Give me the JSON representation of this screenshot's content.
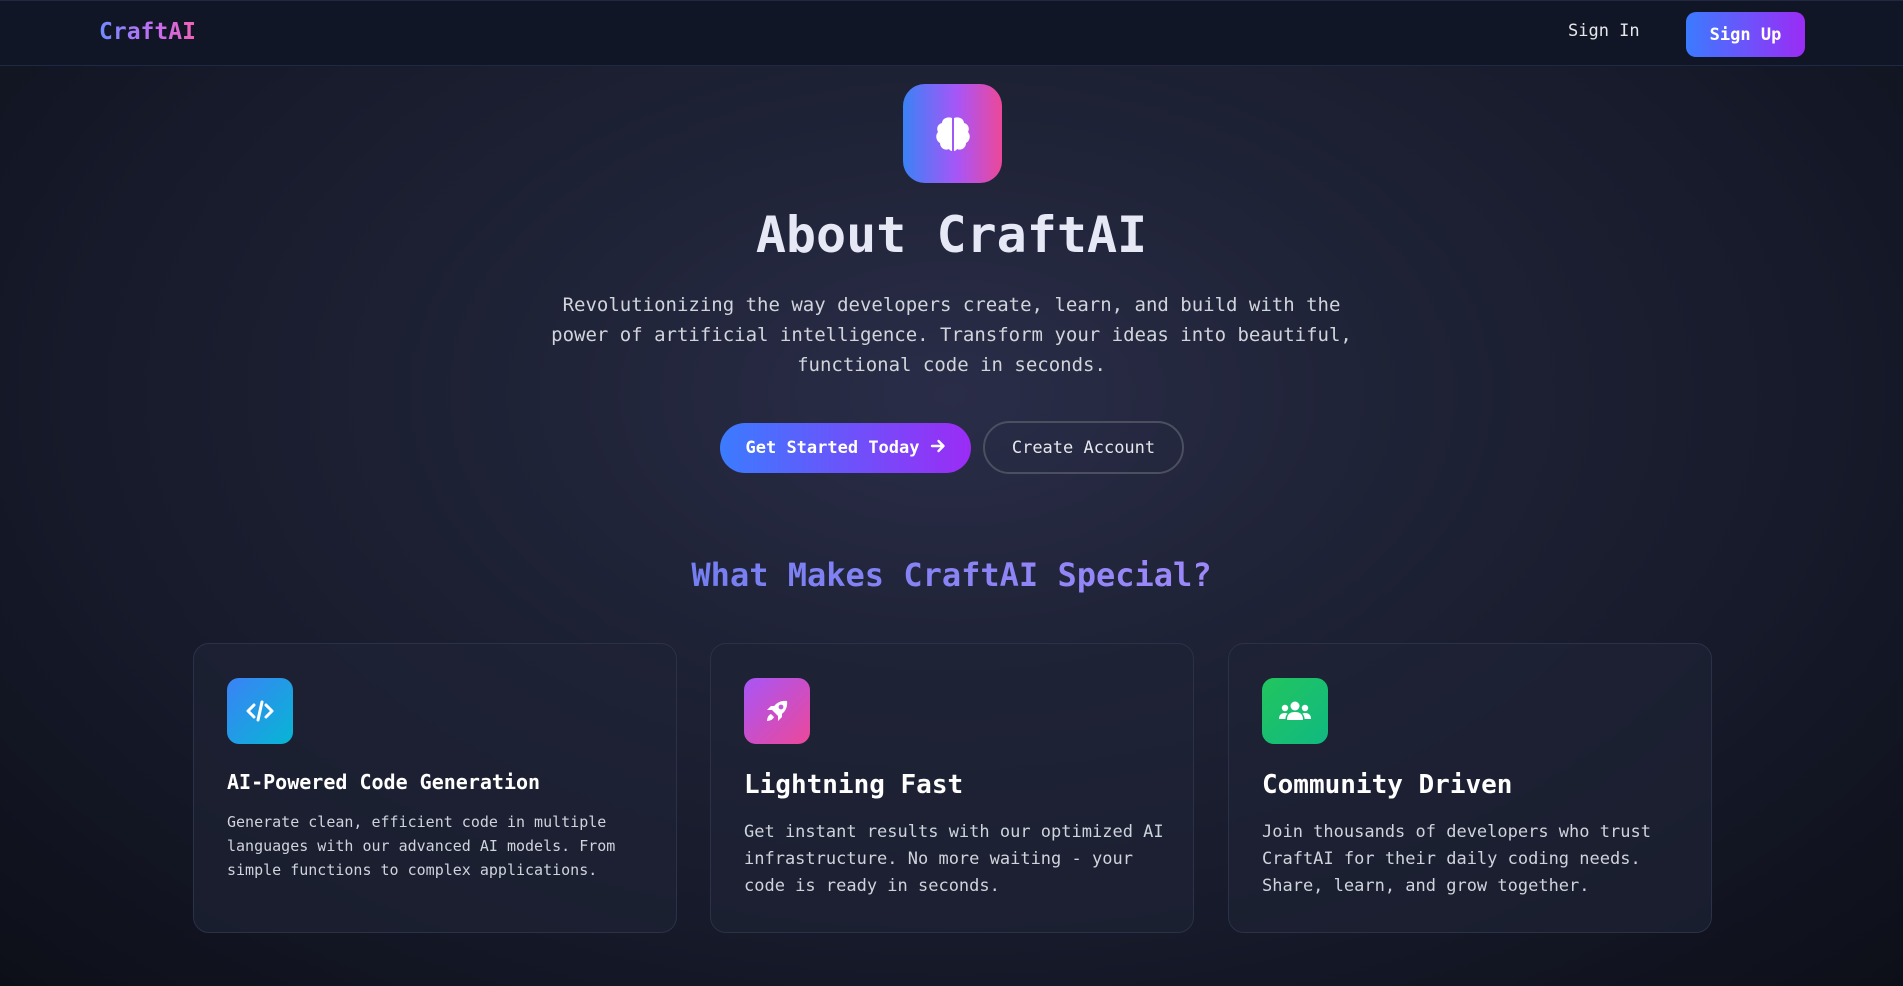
{
  "nav": {
    "brand": "CraftAI",
    "signin_label": "Sign In",
    "signup_label": "Sign Up"
  },
  "hero": {
    "icon": "brain-icon",
    "title": "About CraftAI",
    "subtitle": "Revolutionizing the way developers create, learn, and build with the power of artificial intelligence. Transform your ideas into beautiful, functional code in seconds.",
    "primary_cta": "Get Started Today",
    "primary_cta_icon": "arrow-right-icon",
    "secondary_cta": "Create Account"
  },
  "features": {
    "title": "What Makes CraftAI Special?",
    "items": [
      {
        "icon": "code-icon",
        "title": "AI-Powered Code Generation",
        "description": "Generate clean, efficient code in multiple languages with our advanced AI models. From simple functions to complex applications."
      },
      {
        "icon": "rocket-icon",
        "title": "Lightning Fast",
        "description": "Get instant results with our optimized AI infrastructure. No more waiting - your code is ready in seconds."
      },
      {
        "icon": "users-icon",
        "title": "Community Driven",
        "description": "Join thousands of developers who trust CraftAI for their daily coding needs. Share, learn, and grow together."
      }
    ]
  },
  "colors": {
    "accent_blue": "#3b7bff",
    "accent_purple": "#9b2cf5",
    "accent_pink": "#ec4899",
    "community_green": "#22c55e",
    "background": "#1e2235"
  }
}
